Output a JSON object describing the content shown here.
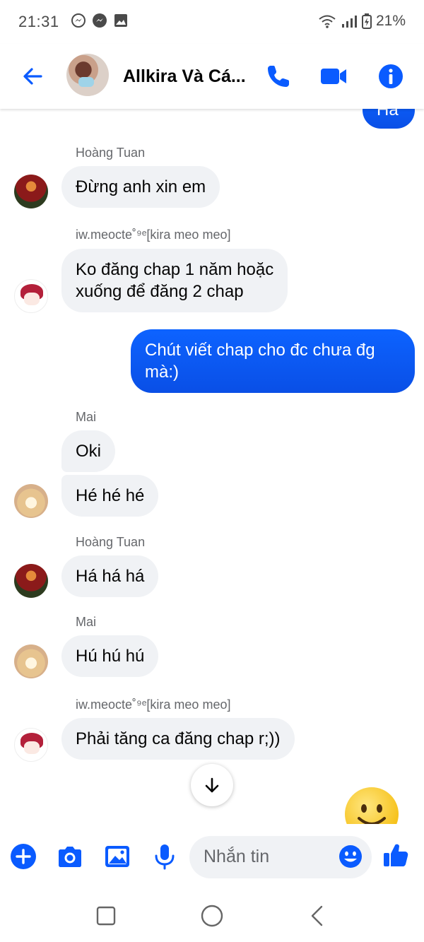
{
  "status_bar": {
    "time": "21:31",
    "battery": "21%"
  },
  "header": {
    "title": "Allkira Và Cá..."
  },
  "messages": [
    {
      "sender": "Hoàng Tuan",
      "text": "Đừng anh xin em"
    },
    {
      "sender": "iw.meocte˚⁹ᵉ[kira meo meo]",
      "text_line1": "Ko đăng chap 1 năm hoặc",
      "text_line2": "xuống để đăng 2 chap"
    },
    {
      "text_line1": "Chút viết chap cho đc chưa đg",
      "text_line2": "mà:)"
    },
    {
      "sender": "Mai",
      "text": "Oki"
    },
    {
      "text": "Hé hé hé"
    },
    {
      "sender": "Hoàng Tuan",
      "text": "Há há há"
    },
    {
      "sender": "Mai",
      "text": "Hú hú hú"
    },
    {
      "sender": "iw.meocte˚⁹ᵉ[kira meo meo]",
      "text": "Phải tăng ca đăng chap r;))"
    }
  ],
  "top_partial": "Há",
  "composer": {
    "placeholder": "Nhắn tin"
  },
  "colors": {
    "accent": "#0a5bff",
    "incoming_bubble": "#f0f2f5",
    "secondary_text": "#65676b"
  },
  "icons": [
    "back-arrow-icon",
    "phone-icon",
    "video-icon",
    "info-icon",
    "plus-icon",
    "camera-icon",
    "image-icon",
    "mic-icon",
    "emoji-icon",
    "thumbs-up-icon",
    "scroll-down-icon",
    "recent-apps-icon",
    "home-icon",
    "back-nav-icon"
  ]
}
